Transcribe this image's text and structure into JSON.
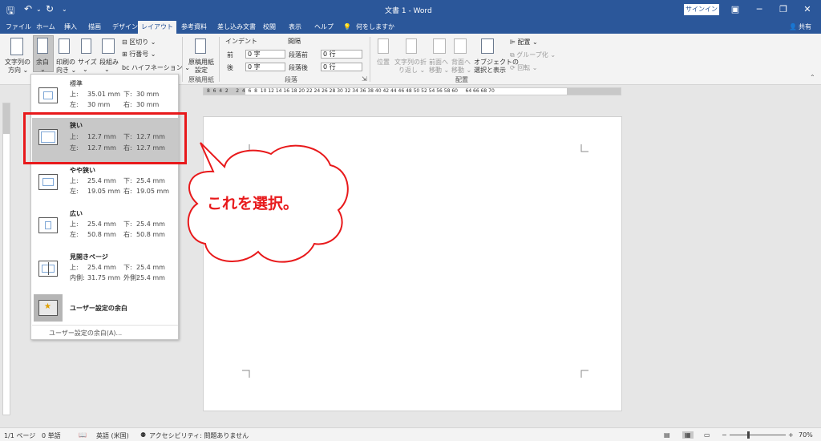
{
  "window": {
    "title": "文書 1 - Word",
    "signin": "サインイン"
  },
  "tabs": [
    "ファイル",
    "ホーム",
    "挿入",
    "描画",
    "デザイン",
    "レイアウト",
    "参考資料",
    "差し込み文書",
    "校閲",
    "表示",
    "ヘルプ"
  ],
  "active_tab": "レイアウト",
  "tell_me": "何をしますか",
  "share": "共有",
  "ribbon": {
    "text_direction": [
      "文字列の",
      "方向 ⌄"
    ],
    "margins": [
      "余白",
      "⌄"
    ],
    "orientation": [
      "印刷の",
      "向き ⌄"
    ],
    "size": [
      "サイズ",
      "⌄"
    ],
    "columns": [
      "段組み",
      "⌄"
    ],
    "breaks": "区切り ⌄",
    "line_numbers": "行番号 ⌄",
    "hyphenation": "ハイフネーション ⌄",
    "manuscript": [
      "原稿用紙",
      "設定"
    ],
    "manuscript_group": "原稿用紙",
    "indent_header": "インデント",
    "spacing_header": "間隔",
    "indent_left_label": "前",
    "indent_left_value": "0 字",
    "indent_right_label": "後",
    "indent_right_value": "0 字",
    "spacing_before_label": "段落前",
    "spacing_before_value": "0 行",
    "spacing_after_label": "段落後",
    "spacing_after_value": "0 行",
    "paragraph_group": "段落",
    "position": "位置",
    "wrap_text": [
      "文字列の折",
      "り返し ⌄"
    ],
    "bring_forward": [
      "前面へ",
      "移動 ⌄"
    ],
    "send_backward": [
      "背面へ",
      "移動 ⌄"
    ],
    "selection_pane": [
      "オブジェクトの",
      "選択と表示"
    ],
    "align": "配置 ⌄",
    "group": "グループ化 ⌄",
    "rotate": "回転 ⌄",
    "arrange_group": "配置"
  },
  "ruler_numbers": "8  6  4  2     2  4  6  8  10 12 14 16 18 20 22 24 26 28 30 32 34 36 38 40 42 44 46 48 50 52 54 56 58 60     64 66 68 70",
  "margin_options": [
    {
      "name": "標準",
      "top_label": "上:",
      "top": "35.01 mm",
      "bottom_label": "下:",
      "bottom": "30 mm",
      "left_label": "左:",
      "left": "30 mm",
      "right_label": "右:",
      "right": "30 mm",
      "selected": false
    },
    {
      "name": "狭い",
      "top_label": "上:",
      "top": "12.7 mm",
      "bottom_label": "下:",
      "bottom": "12.7 mm",
      "left_label": "左:",
      "left": "12.7 mm",
      "right_label": "右:",
      "right": "12.7 mm",
      "selected": true
    },
    {
      "name": "やや狭い",
      "top_label": "上:",
      "top": "25.4 mm",
      "bottom_label": "下:",
      "bottom": "25.4 mm",
      "left_label": "左:",
      "left": "19.05 mm",
      "right_label": "右:",
      "right": "19.05 mm",
      "selected": false
    },
    {
      "name": "広い",
      "top_label": "上:",
      "top": "25.4 mm",
      "bottom_label": "下:",
      "bottom": "25.4 mm",
      "left_label": "左:",
      "left": "50.8 mm",
      "right_label": "右:",
      "right": "50.8 mm",
      "selected": false
    },
    {
      "name": "見開きページ",
      "top_label": "上:",
      "top": "25.4 mm",
      "bottom_label": "下:",
      "bottom": "25.4 mm",
      "left_label": "内側:",
      "left": "31.75 mm",
      "right_label": "外側:",
      "right": "25.4 mm",
      "selected": false
    }
  ],
  "custom_last": "ユーザー設定の余白",
  "custom_margins_link": "ユーザー設定の余白(A)...",
  "callout_text": "これを選択。",
  "status": {
    "page": "1/1 ページ",
    "words": "0 単語",
    "language": "英語 (米国)",
    "accessibility": "アクセシビリティ: 問題ありません",
    "zoom": "70%"
  },
  "colors": {
    "word_blue": "#2b579a",
    "highlight_red": "#e8191b",
    "selected_gray": "#c8c8c8"
  }
}
